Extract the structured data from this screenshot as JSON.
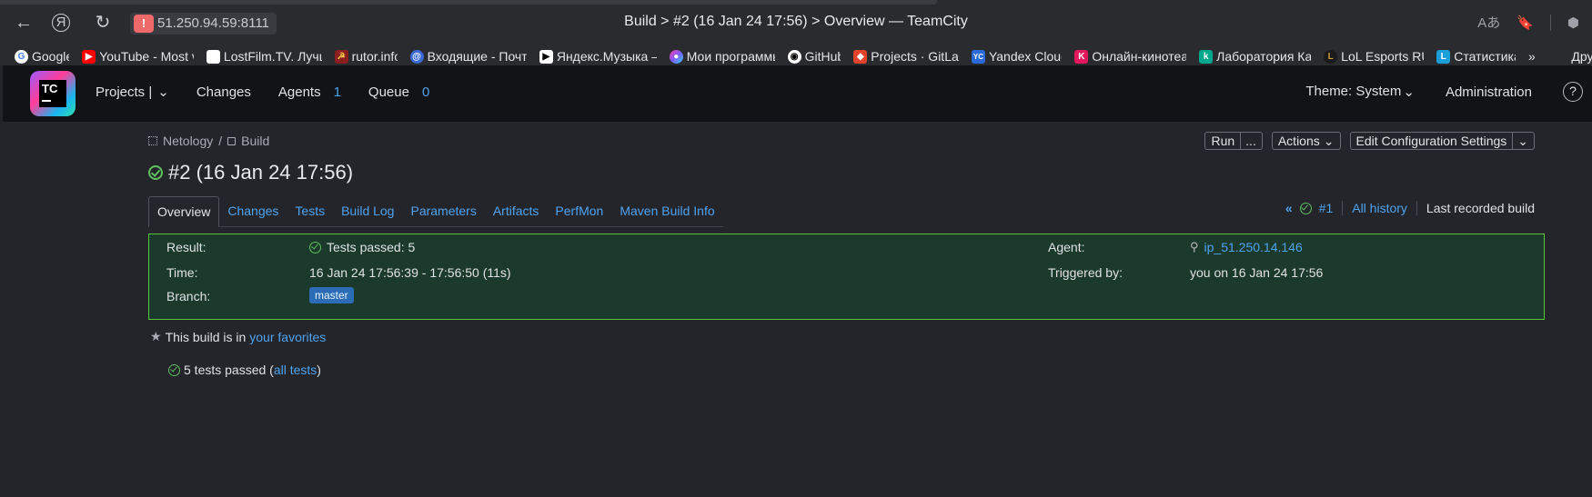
{
  "browser": {
    "url": "51.250.94.59:8111",
    "url_warning": "!",
    "title": "Build > #2 (16 Jan 24 17:56) > Overview — TeamCity",
    "back": "←",
    "yandex": "Я",
    "reload": "↻",
    "right_icons": [
      "Aあ",
      "🔖",
      "⬢"
    ]
  },
  "bookmarks": [
    {
      "label": "Google",
      "icon": "G",
      "color": "#ffffff"
    },
    {
      "label": "YouTube - Most vi",
      "icon": "▶",
      "color": "#ff0000"
    },
    {
      "label": "LostFilm.TV. Лучш",
      "icon": "",
      "color": "#ffffff"
    },
    {
      "label": "rutor.info",
      "icon": "☭",
      "color": "#c0392b"
    },
    {
      "label": "Входящие - Почта",
      "icon": "@",
      "color": "#3b6ad6"
    },
    {
      "label": "Яндекс.Музыка —",
      "icon": "▶",
      "color": "#ffffff"
    },
    {
      "label": "Мои программы",
      "icon": "●",
      "color": "#8e5cf5"
    },
    {
      "label": "GitHub",
      "icon": "◉",
      "color": "#2a2b2f"
    },
    {
      "label": "Projects · GitLab",
      "icon": "◆",
      "color": "#e2432a"
    },
    {
      "label": "Yandex Cloud",
      "icon": "YC",
      "color": "#2a6ad9"
    },
    {
      "label": "Онлайн-кинотеат",
      "icon": "K",
      "color": "#e3175b"
    },
    {
      "label": "Лаборатория Кас",
      "icon": "k",
      "color": "#00a88e"
    },
    {
      "label": "LoL Esports RU",
      "icon": "L",
      "color": "#c89b3c"
    },
    {
      "label": "Статистика",
      "icon": "L",
      "color": "#1a9fd8"
    }
  ],
  "bookmarks_overflow": "»",
  "bookmarks_other": "Дру",
  "header": {
    "logo_text": "TC",
    "nav": [
      {
        "label": "Projects |",
        "chev": "⌄"
      },
      {
        "label": "Changes"
      },
      {
        "label": "Agents",
        "count": "1"
      },
      {
        "label": "Queue",
        "count": "0"
      }
    ],
    "theme": "Theme: System",
    "theme_chev": "⌄",
    "administration": "Administration",
    "help": "?"
  },
  "breadcrumbs": {
    "project": "Netology",
    "separator": "/",
    "build_config": "Build"
  },
  "build": {
    "title": "#2 (16 Jan 24 17:56)"
  },
  "actions": {
    "run": "Run",
    "run_more": "...",
    "actions": "Actions",
    "edit": "Edit Configuration Settings",
    "chev": "⌄"
  },
  "tabs": [
    "Overview",
    "Changes",
    "Tests",
    "Build Log",
    "Parameters",
    "Artifacts",
    "PerfMon",
    "Maven Build Info"
  ],
  "history": {
    "prev_arrow": "«",
    "prev_build": "#1",
    "all_history": "All history",
    "last_recorded": "Last recorded build"
  },
  "details": {
    "result_label": "Result:",
    "result_value": "Tests passed: 5",
    "time_label": "Time:",
    "time_value": "16 Jan 24 17:56:39 - 17:56:50 (11s)",
    "branch_label": "Branch:",
    "branch_value": "master",
    "agent_label": "Agent:",
    "agent_value": "ip_51.250.14.146",
    "triggered_label": "Triggered by:",
    "triggered_value": "you on 16 Jan 24 17:56"
  },
  "favorites": {
    "star": "★",
    "text": "This build is in",
    "link": "your favorites"
  },
  "tests_summary": {
    "text": "5 tests passed (",
    "link": "all tests",
    "close": ")"
  },
  "colors": {
    "accent": "#4ea3f0",
    "success": "#5fc05f",
    "panel_border": "#57c43a",
    "panel_bg": "#1c3a2c",
    "header_bg": "#121316",
    "page_bg": "#23252a"
  }
}
